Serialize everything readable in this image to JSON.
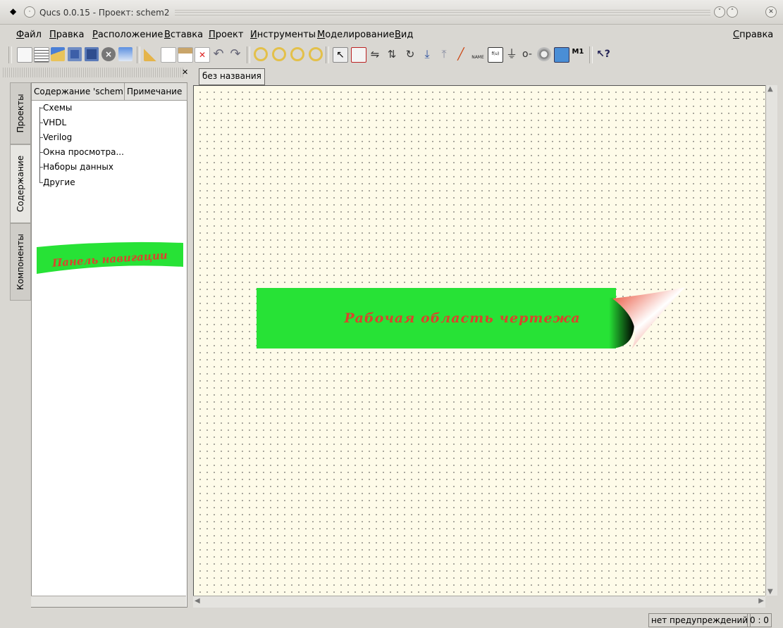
{
  "window": {
    "title": "Qucs 0.0.15 - Проект: schem2"
  },
  "menubar": {
    "items": [
      "Файл",
      "Правка",
      "Расположение",
      "Вставка",
      "Проект",
      "Инструменты",
      "Моделирование",
      "Вид"
    ],
    "help": "Справка"
  },
  "toolbar": {
    "groups": [
      [
        "new-file-icon",
        "new-text-icon",
        "open-file-icon",
        "save-icon",
        "save-all-icon",
        "close-icon",
        "print-icon"
      ],
      [
        "cut-icon",
        "copy-icon",
        "paste-icon",
        "delete-icon",
        "undo-icon",
        "redo-icon"
      ],
      [
        "zoom-fit-icon",
        "zoom-1to1-icon",
        "zoom-in-icon",
        "zoom-out-icon"
      ],
      [
        "select-icon",
        "component-icon",
        "mirror-x-icon",
        "mirror-y-icon",
        "rotate-icon",
        "go-into-icon",
        "pop-out-icon",
        "wire-icon",
        "wire-label-icon",
        "equation-icon",
        "ground-icon",
        "port-icon",
        "simulate-icon",
        "display-icon",
        "marker-icon"
      ],
      [
        "whats-this-icon"
      ]
    ]
  },
  "sidebar": {
    "tabs": [
      "Проекты",
      "Содержание",
      "Компоненты"
    ],
    "active_tab": "Содержание",
    "columns": [
      "Содержание 'schem",
      "Примечание"
    ],
    "tree": [
      "Схемы",
      "VHDL",
      "Verilog",
      "Окна просмотра...",
      "Наборы данных",
      "Другие"
    ],
    "banner": "Панель навигации"
  },
  "document": {
    "tab": "без названия",
    "banner": "Рабочая область чертежа"
  },
  "statusbar": {
    "warnings": "нет предупреждений",
    "coords": "0 : 0"
  },
  "colors": {
    "banner_green": "#27e236",
    "banner_text": "#d9452c",
    "canvas_bg": "#fefbe9"
  }
}
